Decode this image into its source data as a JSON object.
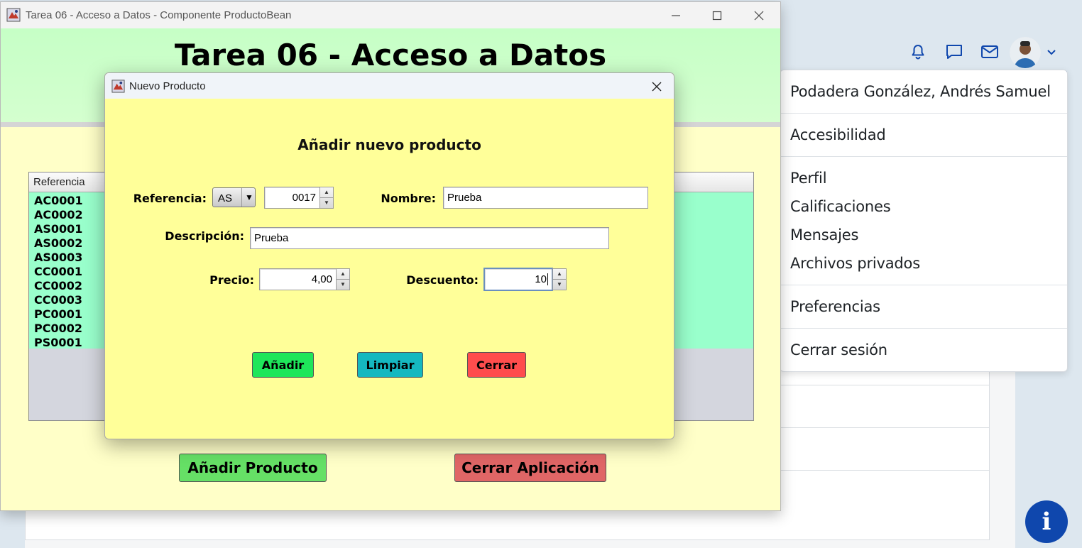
{
  "main_window": {
    "title": "Tarea 06 - Acceso a Datos - Componente ProductoBean",
    "heading": "Tarea 06 - Acceso a Datos",
    "table": {
      "column_header": "Referencia",
      "rows": [
        "AC0001",
        "AC0002",
        "AS0001",
        "AS0002",
        "AS0003",
        "CC0001",
        "CC0002",
        "CC0003",
        "PC0001",
        "PC0002",
        "PS0001"
      ]
    },
    "buttons": {
      "add_product": "Añadir Producto",
      "close_app": "Cerrar Aplicación"
    }
  },
  "dialog": {
    "title": "Nuevo Producto",
    "heading": "Añadir nuevo producto",
    "labels": {
      "referencia": "Referencia:",
      "nombre": "Nombre:",
      "descripcion": "Descripción:",
      "precio": "Precio:",
      "descuento": "Descuento:"
    },
    "values": {
      "referencia_prefix": "AS",
      "referencia_number": "0017",
      "nombre": "Prueba",
      "descripcion": "Prueba",
      "precio": "4,00",
      "descuento": "10"
    },
    "buttons": {
      "add": "Añadir",
      "clear": "Limpiar",
      "close": "Cerrar"
    }
  },
  "user_menu": {
    "user_name": "Podadera González, Andrés Samuel",
    "items": [
      "Accesibilidad",
      "Perfil",
      "Calificaciones",
      "Mensajes",
      "Archivos privados",
      "Preferencias",
      "Cerrar sesión"
    ]
  },
  "colors": {
    "main_bg": "#ffffc8",
    "header_bg": "#c6ffc6",
    "table_rows_bg": "#99ffcc",
    "dialog_bg": "#ffff99",
    "add_button": "#1ee65a",
    "clear_button": "#15b8c0",
    "close_button": "#ff4d4d",
    "brand_blue": "#0f47ad"
  },
  "icons": [
    "app-icon",
    "minimize-icon",
    "maximize-icon",
    "close-icon",
    "bell-icon",
    "chat-icon",
    "mail-icon",
    "chevron-down-icon",
    "info-icon"
  ]
}
